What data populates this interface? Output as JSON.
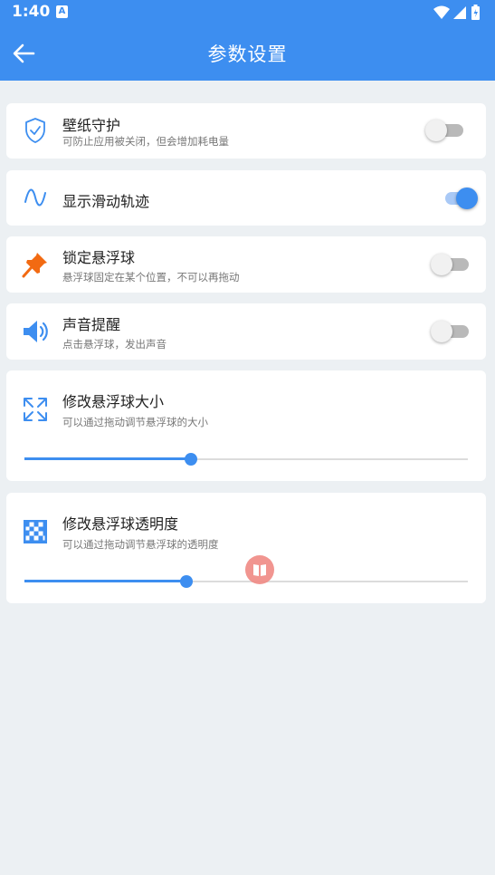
{
  "status_bar": {
    "time": "1:40",
    "notif_badge": "A"
  },
  "app_bar": {
    "title": "参数设置"
  },
  "settings": {
    "wallpaper_guard": {
      "title": "壁纸守护",
      "subtitle": "可防止应用被关闭，但会增加耗电量",
      "enabled": false
    },
    "show_trail": {
      "title": "显示滑动轨迹",
      "enabled": true
    },
    "lock_ball": {
      "title": "锁定悬浮球",
      "subtitle": "悬浮球固定在某个位置，不可以再拖动",
      "enabled": false
    },
    "sound_alert": {
      "title": "声音提醒",
      "subtitle": "点击悬浮球，发出声音",
      "enabled": false
    },
    "ball_size": {
      "title": "修改悬浮球大小",
      "subtitle": "可以通过拖动调节悬浮球的大小",
      "value": 0.375
    },
    "ball_opacity": {
      "title": "修改悬浮球透明度",
      "subtitle": "可以通过拖动调节悬浮球的透明度",
      "value": 0.366
    }
  },
  "colors": {
    "primary": "#3d8ef0",
    "icon_orange": "#f26a12",
    "background": "#ecf0f3"
  }
}
